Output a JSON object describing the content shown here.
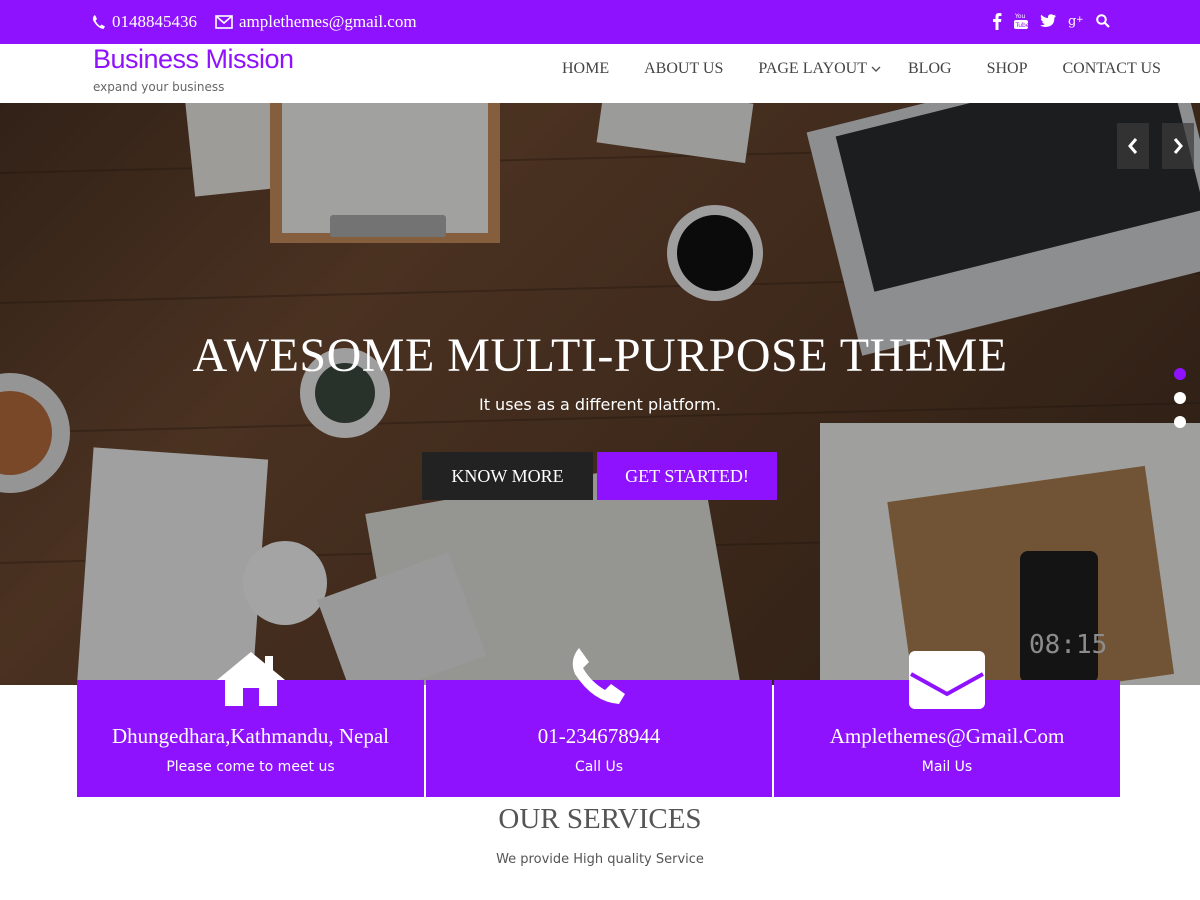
{
  "topbar": {
    "phone": "0148845436",
    "email": "amplethemes@gmail.com",
    "social_icons": [
      "facebook-icon",
      "youtube-icon",
      "twitter-icon",
      "google-plus-icon",
      "search-icon"
    ]
  },
  "header": {
    "brand_title": "Business Mission",
    "brand_tagline": "expand your business",
    "nav": [
      {
        "label": "HOME"
      },
      {
        "label": "ABOUT US"
      },
      {
        "label": "PAGE LAYOUT",
        "has_dropdown": true
      },
      {
        "label": "BLOG"
      },
      {
        "label": "SHOP"
      },
      {
        "label": "CONTACT US"
      }
    ]
  },
  "hero": {
    "title": "AWESOME MULTI-PURPOSE THEME",
    "subtitle": "It uses as a different platform.",
    "btn_primary": "KNOW MORE",
    "btn_secondary": "GET STARTED!",
    "slides": 3,
    "active_slide": 1,
    "clock_text": "08:15"
  },
  "info_boxes": [
    {
      "icon": "home-icon",
      "title": "Dhungedhara,Kathmandu, Nepal",
      "subtitle": "Please come to meet us"
    },
    {
      "icon": "phone-icon",
      "title": "01-234678944",
      "subtitle": "Call Us"
    },
    {
      "icon": "envelope-icon",
      "title": "Amplethemes@Gmail.Com",
      "subtitle": "Mail Us"
    }
  ],
  "services": {
    "title": "OUR SERVICES",
    "subtitle": "We provide High quality Service"
  },
  "colors": {
    "accent": "#8f12fe",
    "dark_button": "#222222",
    "text": "#555555"
  }
}
